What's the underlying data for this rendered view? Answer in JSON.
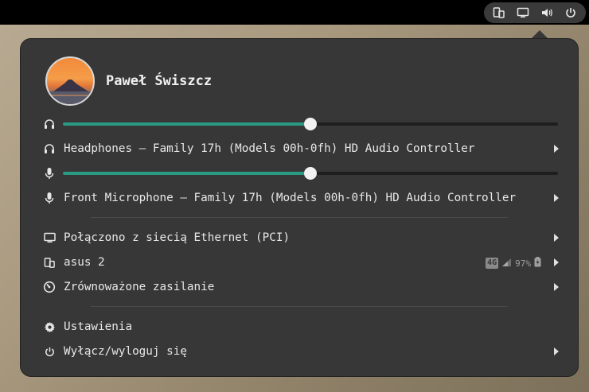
{
  "tray": {
    "icons": [
      "phone-link-icon",
      "display-icon",
      "speaker-icon",
      "power-icon"
    ]
  },
  "user": {
    "name": "Paweł Świszcz"
  },
  "audio": {
    "output_volume_percent": 50,
    "input_volume_percent": 50,
    "output_device": "Headphones – Family 17h (Models 00h-0fh) HD Audio Controller",
    "input_device": "Front Microphone – Family 17h (Models 00h-0fh) HD Audio Controller"
  },
  "network": {
    "label": "Połączono z siecią Ethernet (PCI)"
  },
  "phone": {
    "label": "asus 2",
    "network_type": "4G",
    "battery": "97%"
  },
  "power_profile": {
    "label": "Zrównoważone zasilanie"
  },
  "settings": {
    "label": "Ustawienia"
  },
  "power_off": {
    "label": "Wyłącz/wyloguj się"
  },
  "colors": {
    "accent": "#2a9a82",
    "menu_bg": "#373737",
    "topbar": "#000000"
  }
}
